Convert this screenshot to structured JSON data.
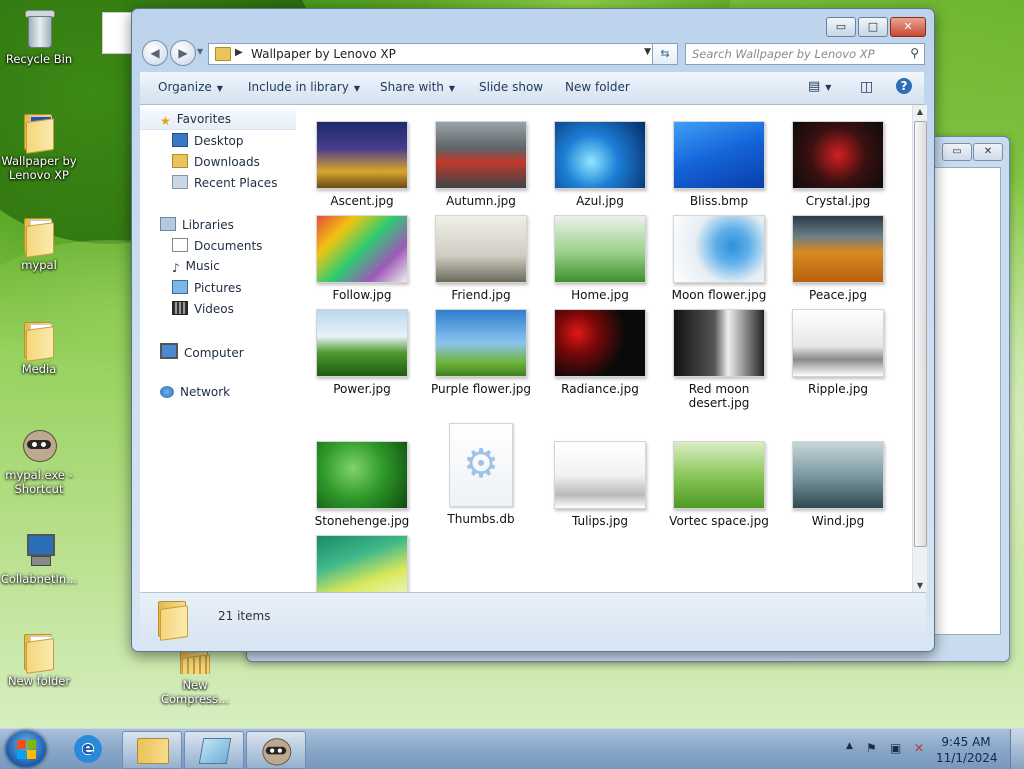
{
  "desktop": {
    "icons": [
      {
        "label": "Recycle Bin"
      },
      {
        "label": "Wallpaper by Lenovo XP"
      },
      {
        "label": "mypal"
      },
      {
        "label": "Media"
      },
      {
        "label": "mypal.exe - Shortcut"
      },
      {
        "label": "CollabnetIn..."
      },
      {
        "label": "New folder"
      },
      {
        "label": "New Compress..."
      }
    ]
  },
  "window": {
    "title_controls": {
      "minimize": "▭",
      "maximize": "□",
      "close": "✕"
    },
    "address": "Wallpaper by Lenovo XP",
    "search_placeholder": "Search Wallpaper by Lenovo XP",
    "toolbar": {
      "organize": "Organize",
      "include": "Include in library",
      "share": "Share with",
      "slideshow": "Slide show",
      "newfolder": "New folder"
    },
    "nav": {
      "favorites": "Favorites",
      "desktop": "Desktop",
      "downloads": "Downloads",
      "recent": "Recent Places",
      "libraries": "Libraries",
      "documents": "Documents",
      "music": "Music",
      "pictures": "Pictures",
      "videos": "Videos",
      "computer": "Computer",
      "network": "Network"
    },
    "files": [
      {
        "name": "Ascent.jpg",
        "thumb": "linear-gradient(180deg,#1b2a6b 0%,#4a3b8c 40%,#d8a62a 75%,#6a4a1a 100%)"
      },
      {
        "name": "Autumn.jpg",
        "thumb": "linear-gradient(180deg,#9aa3a8 0%,#5d6468 40%,#c0392b 60%,#3f4548 100%)"
      },
      {
        "name": "Azul.jpg",
        "thumb": "radial-gradient(circle at 40% 60%,#8fe8ff 0%,#1c7fd6 40%,#062a66 100%)"
      },
      {
        "name": "Bliss.bmp",
        "thumb": "linear-gradient(160deg,#3fa0f5 0%,#1463d9 50%,#0a3ea8 100%)"
      },
      {
        "name": "Crystal.jpg",
        "thumb": "radial-gradient(circle at 50% 50%,#d02020 0%,#3a1010 50%,#0c0c0c 100%)"
      },
      {
        "name": "Follow.jpg",
        "thumb": "linear-gradient(135deg,#e74c3c 0%,#f1c40f 25%,#2ecc71 50%,#9b59b6 75%,#ecf0f1 100%)"
      },
      {
        "name": "Friend.jpg",
        "thumb": "linear-gradient(180deg,#f0efe8 0%,#cfcdc2 60%,#6b6a5a 100%)"
      },
      {
        "name": "Home.jpg",
        "thumb": "linear-gradient(180deg,#e9f3ea 0%,#9bd08a 55%,#3f8f2c 100%)"
      },
      {
        "name": "Moon flower.jpg",
        "thumb": "radial-gradient(circle at 65% 45%,#2f8fd8 0%,#5fb0ea 25%,#e6eef3 55%,#ffffff 100%)"
      },
      {
        "name": "Peace.jpg",
        "thumb": "linear-gradient(180deg,#2a3a45 0%,#6a7d86 30%,#d88a1e 55%,#b85f10 100%)"
      },
      {
        "name": "Power.jpg",
        "thumb": "linear-gradient(180deg,#b9d7ef 0%,#e8f2f8 40%,#4d9a2e 65%,#1f5a12 100%)"
      },
      {
        "name": "Purple flower.jpg",
        "thumb": "linear-gradient(180deg,#2f7fcf 0%,#8cc3ef 50%,#6db43a 80%,#3f7f1f 100%)"
      },
      {
        "name": "Radiance.jpg",
        "thumb": "radial-gradient(circle at 25% 35%,#e01818 0%,#7a0808 25%,#0a0a0a 60%)"
      },
      {
        "name": "Red moon desert.jpg",
        "thumb": "linear-gradient(90deg,#111111 0%,#555555 45%,#eeeeee 60%,#222222 100%)"
      },
      {
        "name": "Ripple.jpg",
        "thumb": "linear-gradient(180deg,#ffffff 0%,#e6e6e6 55%,#8a8a8a 75%,#ffffff 100%)"
      },
      {
        "name": "Stonehenge.jpg",
        "thumb": "radial-gradient(circle at 40% 40%,#7fd36a 0%,#2f9a2a 45%,#0f4a10 100%)"
      },
      {
        "name": "Thumbs.db",
        "thumb": "file"
      },
      {
        "name": "Tulips.jpg",
        "thumb": "linear-gradient(180deg,#ffffff 0%,#f2f2f2 50%,#b9b9b9 80%,#ffffff 100%)"
      },
      {
        "name": "Vortec space.jpg",
        "thumb": "linear-gradient(180deg,#d9eec5 0%,#8cc75a 50%,#4e9a25 100%)"
      },
      {
        "name": "Wind.jpg",
        "thumb": "linear-gradient(180deg,#c7d6dc 0%,#7e9aa3 50%,#2d4a52 100%)"
      },
      {
        "name": "",
        "thumb": "linear-gradient(160deg,#1b8a6a 0%,#3fb88a 35%,#d9e85a 65%,#f2f7d8 100%)"
      }
    ],
    "status": "21 items"
  },
  "taskbar": {
    "time": "9:45 AM",
    "date": "11/1/2024"
  },
  "colors": {
    "window_border": "#5a7493",
    "toolbar_text": "#1e395b",
    "desktop_green": "#6cb42e"
  }
}
